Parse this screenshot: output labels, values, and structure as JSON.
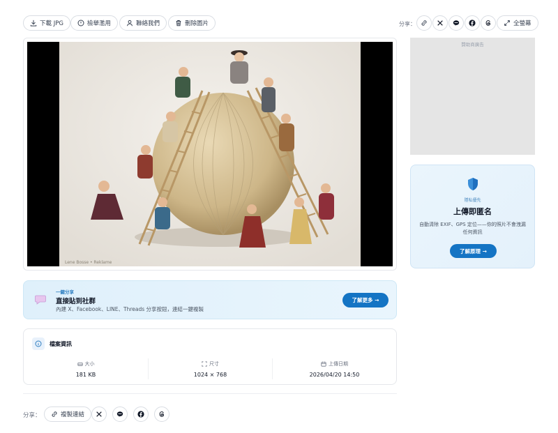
{
  "toolbar": {
    "download_label": "下載 JPG",
    "report_label": "檢舉濫用",
    "contact_label": "聯絡我們",
    "delete_label": "刪除圖片",
    "share_label": "分享：",
    "fullscreen_label": "全螢幕"
  },
  "image_caption": "Lene Bosse • Reklame",
  "ad": {
    "label": "贊助商廣告"
  },
  "privacy_card": {
    "eyebrow": "隱私優先",
    "title": "上傳即匿名",
    "description": "自動清除 EXIF、GPS 定位——你的照片不會洩漏任何資訊",
    "button_label": "了解原理 →"
  },
  "share_banner": {
    "eyebrow": "一鍵分享",
    "title": "直接貼到社群",
    "description": "內建 X、Facebook、LINE、Threads 分享按鈕，連結一鍵複製",
    "button_label": "了解更多 →"
  },
  "file_info": {
    "title": "檔案資訊",
    "size_label": "大小",
    "size_value": "181 KB",
    "dimensions_label": "尺寸",
    "dimensions_value": "1024 × 768",
    "upload_label": "上傳日期",
    "upload_value": "2026/04/20 14:50"
  },
  "bottom_share": {
    "label": "分享：",
    "copy_link_label": "複製連結"
  },
  "colors": {
    "accent": "#1474c4",
    "banner_bg": "#dff0fb",
    "ad_bg": "#e5e5e5"
  },
  "icons": [
    "download-icon",
    "alert-icon",
    "user-icon",
    "trash-icon",
    "link-icon",
    "x-icon",
    "line-icon",
    "facebook-icon",
    "threads-icon",
    "expand-icon",
    "shield-icon",
    "chat-bubble-icon",
    "info-icon",
    "drive-icon",
    "crop-icon",
    "calendar-icon"
  ]
}
